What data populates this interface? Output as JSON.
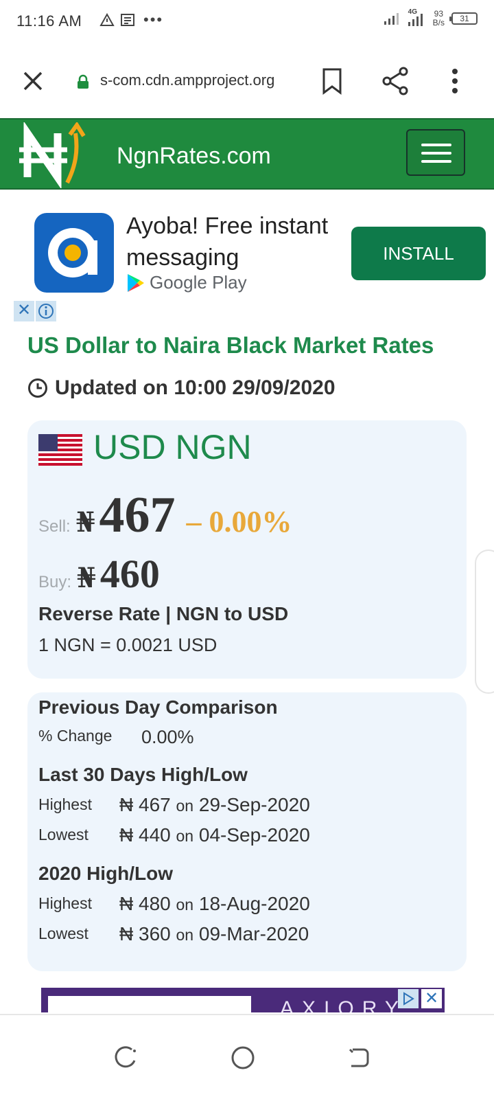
{
  "status_bar": {
    "time": "11:16 AM",
    "network": "4G",
    "speed_value": "93",
    "speed_unit": "B/s",
    "battery": "31"
  },
  "browser": {
    "url": "s-com.cdn.ampproject.org"
  },
  "site": {
    "name": "NgnRates.com",
    "brand_color": "#1f8a3e"
  },
  "ad": {
    "app_title": "Ayoba! Free instant messaging",
    "store": "Google Play",
    "install_label": "INSTALL",
    "close_symbol": "✕"
  },
  "page": {
    "title": "US Dollar to Naira Black Market Rates",
    "updated": "Updated on 10:00 29/09/2020"
  },
  "rate_card": {
    "pair": "USD NGN",
    "sell_label": "Sell:",
    "currency_symbol": "₦",
    "sell_rate": "467",
    "change": "– 0.00%",
    "buy_label": "Buy:",
    "buy_rate": "460",
    "reverse_title": "Reverse Rate | NGN to USD",
    "reverse_value": "1 NGN = 0.0021 USD"
  },
  "comparison": {
    "prev_title": "Previous Day Comparison",
    "pct_label": "% Change",
    "pct_value": "0.00%",
    "last30_title": "Last 30 Days High/Low",
    "last30": [
      {
        "label": "Highest",
        "value": "₦ 467",
        "on": "on",
        "date": "29-Sep-2020"
      },
      {
        "label": "Lowest",
        "value": "₦ 440",
        "on": "on",
        "date": "04-Sep-2020"
      }
    ],
    "year_title": "2020 High/Low",
    "year": [
      {
        "label": "Highest",
        "value": "₦ 480",
        "on": "on",
        "date": "18-Aug-2020"
      },
      {
        "label": "Lowest",
        "value": "₦ 360",
        "on": "on",
        "date": "09-Mar-2020"
      }
    ]
  },
  "banner": {
    "text": "AXIORY",
    "close_symbol": "✕"
  }
}
